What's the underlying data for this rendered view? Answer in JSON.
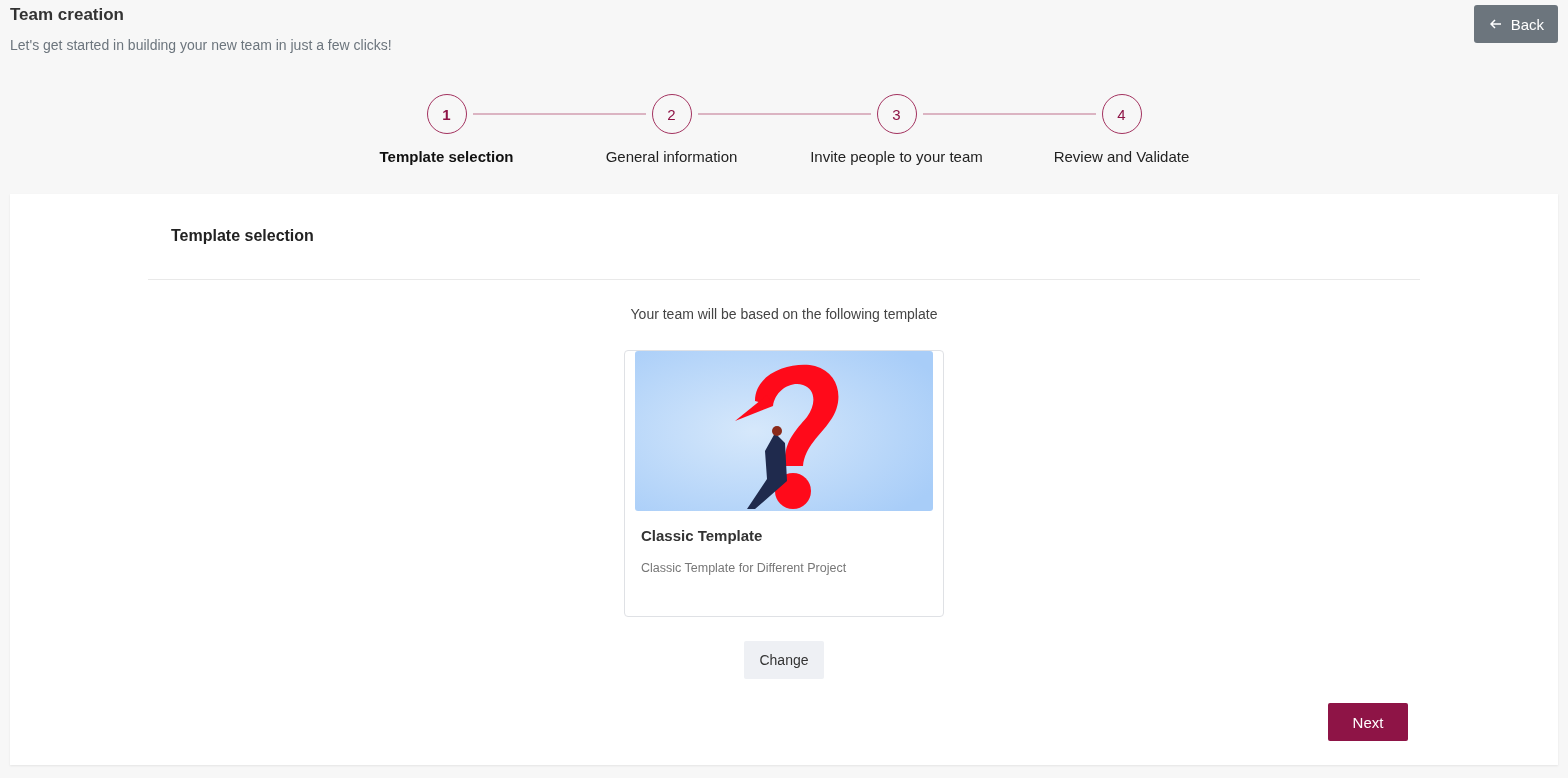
{
  "header": {
    "title": "Team creation",
    "subtitle": "Let's get started in building your new team in just a few clicks!",
    "back_button": "Back"
  },
  "steps": [
    {
      "number": "1",
      "label": "Template selection",
      "selected": true
    },
    {
      "number": "2",
      "label": "General information",
      "selected": false
    },
    {
      "number": "3",
      "label": "Invite people to your team",
      "selected": false
    },
    {
      "number": "4",
      "label": "Review and Validate",
      "selected": false
    }
  ],
  "panel": {
    "title": "Template selection",
    "intro": "Your team will be based on the following template",
    "template_card": {
      "name": "Classic Template",
      "description": "Classic Template for Different Project"
    },
    "change_button": "Change",
    "next_button": "Next"
  }
}
